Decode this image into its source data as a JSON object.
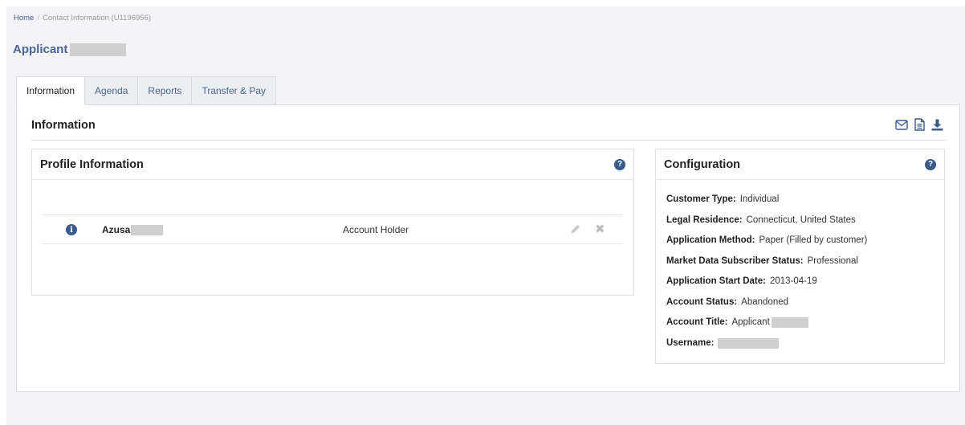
{
  "breadcrumb": {
    "home": "Home",
    "separator": "/",
    "current": "Contact Information (U1196956)"
  },
  "applicant": {
    "label": "Applicant"
  },
  "tabs": [
    {
      "label": "Information",
      "active": true
    },
    {
      "label": "Agenda",
      "active": false
    },
    {
      "label": "Reports",
      "active": false
    },
    {
      "label": "Transfer & Pay",
      "active": false
    }
  ],
  "section": {
    "title": "Information",
    "icons": [
      "envelope-icon",
      "document-icon",
      "download-icon"
    ]
  },
  "profile": {
    "title": "Profile Information",
    "help_glyph": "?",
    "rows": [
      {
        "info_glyph": "i",
        "name": "Azusa",
        "role": "Account Holder"
      }
    ],
    "delete_glyph": "✖"
  },
  "configuration": {
    "title": "Configuration",
    "help_glyph": "?",
    "items": [
      {
        "key": "Customer Type:",
        "value": "Individual"
      },
      {
        "key": "Legal Residence:",
        "value": "Connecticut, United States"
      },
      {
        "key": "Application Method:",
        "value": "Paper (Filled by customer)"
      },
      {
        "key": "Market Data Subscriber Status:",
        "value": "Professional"
      },
      {
        "key": "Application Start Date:",
        "value": "2013-04-19"
      },
      {
        "key": "Account Status:",
        "value": "Abandoned"
      },
      {
        "key": "Account Title:",
        "value": "Applicant"
      },
      {
        "key": "Username:",
        "value": ""
      }
    ]
  },
  "colors": {
    "accent": "#4a6494",
    "help_badge": "#3a5a8a",
    "border": "#d9dce1",
    "redaction": "#cfcfcf"
  }
}
